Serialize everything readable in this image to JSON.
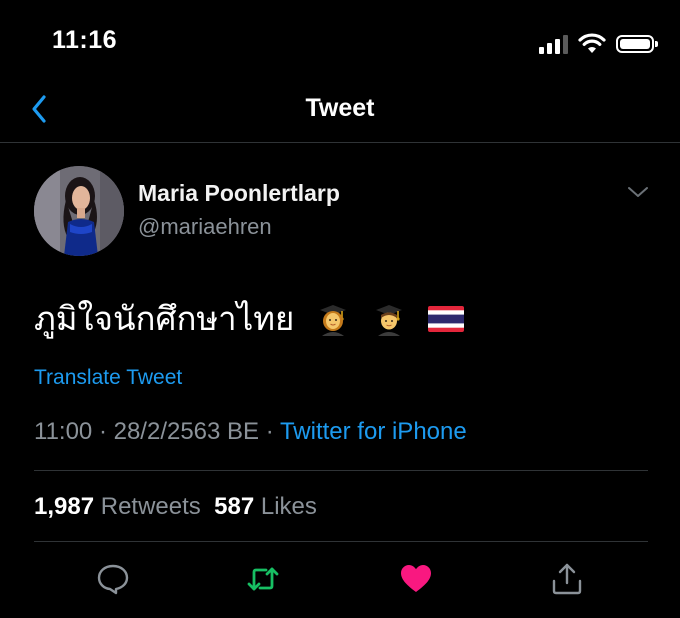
{
  "status_bar": {
    "time": "11:16",
    "icons": [
      "signal-icon",
      "wifi-icon",
      "battery-icon"
    ]
  },
  "header": {
    "title": "Tweet",
    "back_icon": "chevron-left-icon"
  },
  "tweet": {
    "author_name": "Maria Poonlertlarp",
    "author_handle": "@mariaehren",
    "text": "ภูมิใจนักศึกษาไทย",
    "emojis": [
      "woman-student-emoji",
      "man-student-emoji",
      "thailand-flag-emoji"
    ],
    "translate_label": "Translate Tweet",
    "timestamp": "11:00 · 28/2/2563 BE · ",
    "source": "Twitter for iPhone",
    "retweets_count": "1,987",
    "retweets_label": "Retweets",
    "likes_count": "587",
    "likes_label": "Likes"
  },
  "actions": [
    {
      "name": "reply",
      "icon": "comment-icon"
    },
    {
      "name": "retweet",
      "icon": "retweet-icon"
    },
    {
      "name": "like",
      "icon": "heart-icon"
    },
    {
      "name": "share",
      "icon": "share-icon"
    }
  ],
  "colors": {
    "background": "#000000",
    "accent_blue": "#1d9bf0",
    "secondary_text": "#8b9299",
    "retweet_green": "#17bf63",
    "like_pink": "#f91880",
    "divider": "#2f3336"
  }
}
